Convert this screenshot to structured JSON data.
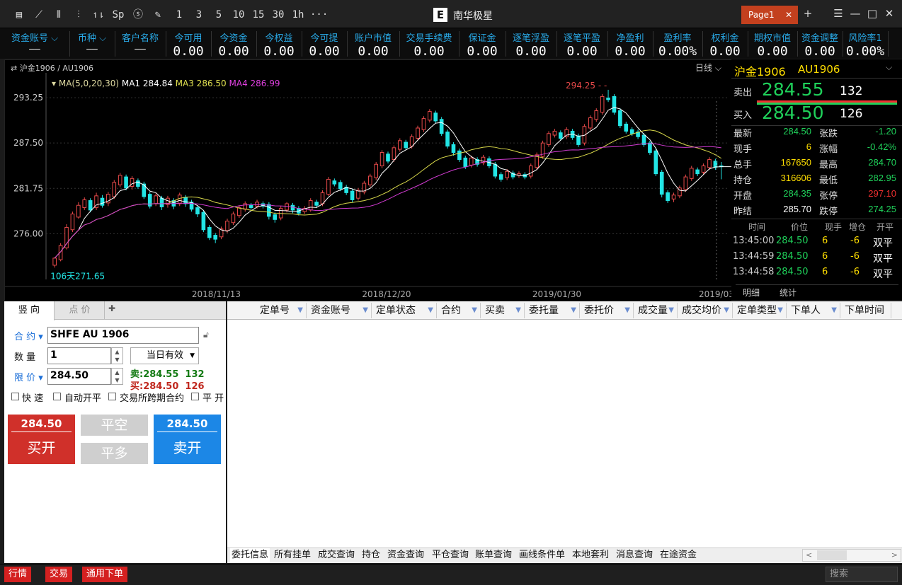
{
  "app": {
    "title": "南华极星",
    "page_tab": "Page1",
    "close": "✕",
    "add": "+"
  },
  "toolbar": {
    "icons": [
      "menu-icon",
      "line-chart-icon",
      "candle-icon",
      "bar-icon",
      "tick-icon",
      "sp-icon",
      "s-box-icon",
      "pen-icon"
    ],
    "periods": [
      "1",
      "3",
      "5",
      "10",
      "15",
      "30",
      "1h"
    ],
    "more": "···"
  },
  "window": {
    "list": "☰",
    "min": "—",
    "max": "□",
    "close": "✕"
  },
  "summary": [
    {
      "label": "资金账号",
      "value": "——",
      "dropdown": true
    },
    {
      "label": "币种",
      "value": "——",
      "dropdown": true
    },
    {
      "label": "客户名称",
      "value": "——"
    },
    {
      "label": "今可用",
      "value": "0.00"
    },
    {
      "label": "今资金",
      "value": "0.00"
    },
    {
      "label": "今权益",
      "value": "0.00"
    },
    {
      "label": "今可提",
      "value": "0.00"
    },
    {
      "label": "账户市值",
      "value": "0.00"
    },
    {
      "label": "交易手续费",
      "value": "0.00"
    },
    {
      "label": "保证金",
      "value": "0.00"
    },
    {
      "label": "逐笔浮盈",
      "value": "0.00"
    },
    {
      "label": "逐笔平盈",
      "value": "0.00"
    },
    {
      "label": "净盈利",
      "value": "0.00"
    },
    {
      "label": "盈利率",
      "value": "0.00%"
    },
    {
      "label": "权利金",
      "value": "0.00"
    },
    {
      "label": "期权市值",
      "value": "0.00"
    },
    {
      "label": "资金调整",
      "value": "0.00"
    },
    {
      "label": "风险率1",
      "value": "0.00%"
    }
  ],
  "chart": {
    "symbol_label": "沪金1906 / AU1906",
    "period": "日线",
    "ma_title": "MA(5,0,20,30)",
    "ma1": "MA1 284.84",
    "ma3": "MA3 286.50",
    "ma4": "MA4 286.99",
    "high_marker": "294.25",
    "low_marker": "271.65",
    "low_prefix": "106天",
    "dates": [
      "2018/11/13",
      "2018/12/20",
      "2019/01/30",
      "2019/03"
    ]
  },
  "chart_data": {
    "type": "candlestick",
    "y_ticks": [
      "293.25",
      "287.50",
      "281.75",
      "276.00"
    ],
    "ylim": [
      270.2,
      295.5
    ],
    "candles": [
      [
        272.0,
        272.9,
        271.7,
        273.0
      ],
      [
        272.7,
        274.5,
        272.5,
        274.8
      ],
      [
        274.2,
        276.8,
        274.0,
        277.2
      ],
      [
        276.5,
        278.5,
        276.2,
        278.8
      ],
      [
        278.1,
        279.6,
        277.9,
        280.0
      ],
      [
        279.3,
        280.3,
        279.0,
        280.6
      ],
      [
        280.2,
        279.0,
        278.7,
        280.5
      ],
      [
        279.3,
        280.8,
        279.0,
        281.2
      ],
      [
        280.5,
        279.6,
        279.3,
        280.9
      ],
      [
        279.9,
        281.0,
        279.5,
        281.3
      ],
      [
        280.7,
        282.5,
        280.4,
        282.8
      ],
      [
        282.2,
        283.4,
        281.9,
        283.7
      ],
      [
        283.2,
        281.8,
        281.5,
        283.5
      ],
      [
        282.0,
        283.0,
        281.6,
        283.3
      ],
      [
        282.7,
        282.0,
        281.7,
        283.0
      ],
      [
        282.3,
        280.7,
        280.4,
        282.6
      ],
      [
        281.0,
        279.5,
        279.2,
        281.3
      ],
      [
        279.8,
        280.8,
        279.5,
        281.1
      ],
      [
        280.5,
        279.4,
        279.0,
        280.8
      ],
      [
        279.7,
        280.5,
        279.3,
        280.8
      ],
      [
        280.2,
        279.5,
        279.1,
        280.5
      ],
      [
        279.8,
        280.9,
        279.5,
        281.2
      ],
      [
        280.6,
        279.8,
        279.4,
        280.9
      ],
      [
        280.0,
        279.1,
        278.8,
        280.3
      ],
      [
        279.3,
        278.5,
        278.1,
        279.6
      ],
      [
        278.7,
        276.5,
        276.2,
        279.0
      ],
      [
        276.8,
        275.5,
        275.2,
        277.1
      ],
      [
        275.8,
        275.3,
        274.8,
        276.1
      ],
      [
        275.6,
        276.6,
        275.3,
        276.9
      ],
      [
        276.4,
        277.6,
        276.1,
        277.9
      ],
      [
        277.4,
        278.5,
        277.1,
        278.8
      ],
      [
        278.3,
        279.3,
        278.0,
        279.6
      ],
      [
        279.1,
        279.8,
        278.8,
        280.1
      ],
      [
        279.6,
        279.3,
        279.0,
        279.9
      ],
      [
        279.5,
        280.0,
        279.2,
        280.3
      ],
      [
        279.8,
        279.5,
        279.2,
        280.1
      ],
      [
        279.7,
        278.2,
        277.8,
        280.0
      ],
      [
        278.4,
        277.8,
        277.4,
        278.7
      ],
      [
        278.0,
        279.2,
        277.7,
        279.5
      ],
      [
        279.0,
        279.8,
        278.7,
        280.0
      ],
      [
        279.6,
        279.0,
        278.6,
        279.9
      ],
      [
        279.2,
        278.6,
        278.3,
        279.5
      ],
      [
        278.8,
        279.2,
        278.5,
        279.5
      ],
      [
        279.0,
        280.2,
        278.8,
        280.5
      ],
      [
        280.0,
        279.6,
        279.3,
        280.3
      ],
      [
        279.8,
        281.2,
        279.5,
        281.5
      ],
      [
        281.0,
        282.9,
        280.8,
        283.2
      ],
      [
        282.7,
        282.3,
        282.0,
        283.0
      ],
      [
        282.5,
        281.7,
        281.4,
        282.8
      ],
      [
        281.9,
        281.2,
        280.9,
        282.2
      ],
      [
        281.4,
        280.3,
        280.0,
        281.7
      ],
      [
        280.5,
        281.5,
        280.2,
        281.8
      ],
      [
        281.3,
        282.4,
        281.0,
        282.7
      ],
      [
        282.2,
        283.3,
        281.9,
        283.6
      ],
      [
        283.1,
        284.8,
        282.8,
        285.1
      ],
      [
        284.6,
        286.3,
        284.3,
        286.6
      ],
      [
        286.1,
        285.2,
        284.9,
        286.4
      ],
      [
        285.4,
        286.9,
        285.1,
        287.2
      ],
      [
        286.7,
        287.8,
        286.4,
        288.1
      ],
      [
        287.6,
        286.9,
        286.6,
        287.9
      ],
      [
        287.1,
        288.3,
        286.8,
        288.6
      ],
      [
        288.1,
        289.4,
        287.8,
        289.7
      ],
      [
        289.2,
        290.6,
        288.9,
        290.9
      ],
      [
        290.4,
        291.5,
        290.1,
        291.8
      ],
      [
        291.3,
        290.3,
        290.0,
        291.6
      ],
      [
        290.5,
        288.7,
        288.4,
        290.8
      ],
      [
        288.9,
        287.1,
        286.8,
        289.2
      ],
      [
        287.3,
        286.3,
        285.9,
        287.6
      ],
      [
        286.5,
        285.4,
        285.1,
        286.8
      ],
      [
        285.6,
        284.5,
        284.2,
        285.9
      ],
      [
        284.7,
        285.6,
        284.4,
        285.9
      ],
      [
        285.4,
        284.8,
        284.5,
        285.7
      ],
      [
        285.0,
        285.7,
        284.7,
        286.0
      ],
      [
        285.5,
        284.6,
        284.3,
        285.8
      ],
      [
        284.8,
        283.3,
        283.0,
        285.1
      ],
      [
        283.5,
        282.9,
        282.6,
        283.8
      ],
      [
        283.1,
        283.9,
        282.8,
        284.2
      ],
      [
        283.7,
        283.2,
        282.9,
        284.0
      ],
      [
        283.4,
        283.6,
        283.1,
        283.9
      ],
      [
        283.5,
        283.2,
        282.9,
        283.8
      ],
      [
        283.3,
        284.6,
        283.0,
        284.9
      ],
      [
        284.4,
        286.0,
        284.1,
        286.3
      ],
      [
        285.8,
        287.5,
        285.5,
        287.8
      ],
      [
        287.3,
        288.7,
        287.0,
        289.0
      ],
      [
        288.5,
        289.0,
        288.2,
        289.3
      ],
      [
        288.8,
        288.1,
        287.8,
        289.1
      ],
      [
        288.3,
        289.2,
        288.0,
        289.5
      ],
      [
        289.0,
        288.2,
        287.9,
        289.3
      ],
      [
        288.4,
        287.3,
        287.0,
        288.7
      ],
      [
        287.5,
        289.6,
        287.2,
        289.9
      ],
      [
        289.4,
        290.7,
        289.1,
        291.0
      ],
      [
        290.5,
        291.6,
        290.2,
        291.9
      ],
      [
        291.4,
        293.4,
        291.1,
        293.7
      ],
      [
        293.2,
        293.0,
        292.7,
        294.25
      ],
      [
        293.4,
        291.4,
        291.1,
        293.7
      ],
      [
        291.6,
        289.7,
        289.4,
        291.9
      ],
      [
        289.9,
        289.0,
        288.7,
        290.2
      ],
      [
        289.2,
        288.7,
        288.4,
        289.5
      ],
      [
        288.9,
        288.3,
        288.0,
        289.2
      ],
      [
        288.5,
        287.3,
        287.0,
        288.8
      ],
      [
        287.5,
        286.3,
        286.0,
        287.8
      ],
      [
        286.5,
        283.6,
        283.3,
        286.8
      ],
      [
        283.8,
        281.0,
        280.6,
        284.1
      ],
      [
        281.2,
        280.2,
        279.9,
        281.5
      ],
      [
        280.4,
        280.9,
        280.0,
        281.2
      ],
      [
        280.8,
        281.8,
        280.5,
        282.1
      ],
      [
        281.6,
        283.2,
        281.3,
        283.5
      ],
      [
        283.0,
        284.3,
        282.7,
        284.6
      ],
      [
        284.1,
        283.6,
        283.3,
        284.4
      ],
      [
        283.8,
        284.6,
        283.5,
        284.9
      ],
      [
        284.4,
        285.4,
        284.1,
        285.7
      ],
      [
        285.2,
        284.4,
        284.1,
        285.5
      ],
      [
        284.6,
        284.5,
        282.9,
        285.1
      ]
    ]
  },
  "sidebar": {
    "title": "沪金1906",
    "code": "AU1906",
    "sell_label": "卖出",
    "sell_price": "284.55",
    "sell_qty": "132",
    "buy_label": "买入",
    "buy_price": "284.50",
    "buy_qty": "126",
    "stats": [
      {
        "l": "最新",
        "v": "284.50",
        "vc": "green",
        "l2": "张跌",
        "v2": "-1.20",
        "vc2": "green"
      },
      {
        "l": "现手",
        "v": "6",
        "vc": "yellow",
        "l2": "涨幅",
        "v2": "-0.42%",
        "vc2": "green"
      },
      {
        "l": "总手",
        "v": "167650",
        "vc": "yellow",
        "l2": "最高",
        "v2": "284.70",
        "vc2": "green"
      },
      {
        "l": "持仓",
        "v": "316606",
        "vc": "yellow",
        "l2": "最低",
        "v2": "282.95",
        "vc2": "green"
      },
      {
        "l": "开盘",
        "v": "284.35",
        "vc": "green",
        "l2": "张停",
        "v2": "297.10",
        "vc2": "red"
      },
      {
        "l": "昨结",
        "v": "285.70",
        "vc": "white",
        "l2": "跌停",
        "v2": "274.25",
        "vc2": "green"
      }
    ],
    "trade_headers": [
      "时间",
      "价位",
      "现手",
      "增仓",
      "开平"
    ],
    "trades": [
      {
        "time": "13:45:00",
        "price": "284.50",
        "qty": "6",
        "inc": "-6",
        "type": "双平"
      },
      {
        "time": "13:44:59",
        "price": "284.50",
        "qty": "6",
        "inc": "-6",
        "type": "双平"
      },
      {
        "time": "13:44:58",
        "price": "284.50",
        "qty": "6",
        "inc": "-6",
        "type": "双平"
      }
    ],
    "tabs": [
      "明细",
      "统计"
    ]
  },
  "order": {
    "tabs": [
      "竖 向",
      "点 价"
    ],
    "add": "✚",
    "contract_label": "合 约",
    "contract_value": "SHFE AU 1906",
    "qty_label": "数 量",
    "qty_value": "1",
    "validity": "当日有效",
    "price_label": "限 价",
    "price_value": "284.50",
    "ask_line": "卖:284.55  132",
    "bid_line": "买:284.50  126",
    "checks": [
      "快 速",
      "自动开平",
      "交易所跨期合约",
      "平 开"
    ],
    "buy_price": "284.50",
    "buy_label": "买开",
    "close_short": "平空",
    "close_long": "平多",
    "sell_price": "284.50",
    "sell_label": "卖开"
  },
  "grid": {
    "headers": [
      "定单号",
      "资金账号",
      "定单状态",
      "合约",
      "买卖",
      "委托量",
      "委托价",
      "成交量",
      "成交均价",
      "定单类型",
      "下单人",
      "下单时间"
    ],
    "bottom_tabs": [
      "委托信息",
      "所有挂单",
      "成交查询",
      "持仓",
      "资金查询",
      "平仓查询",
      "账单查询",
      "画线条件单",
      "本地套利",
      "消息查询",
      "在途资金"
    ]
  },
  "status": {
    "btn1": "行情",
    "btn2": "交易",
    "btn3": "通用下单",
    "search_placeholder": "搜索"
  },
  "colors": {
    "up": "#e84a4a",
    "down": "#22e5e5",
    "ma1": "#ffffff",
    "ma3": "#d8d84a",
    "ma4": "#d23bd2",
    "accent": "#29a9e6",
    "buy": "#d0302a",
    "sell": "#1c87e6"
  }
}
